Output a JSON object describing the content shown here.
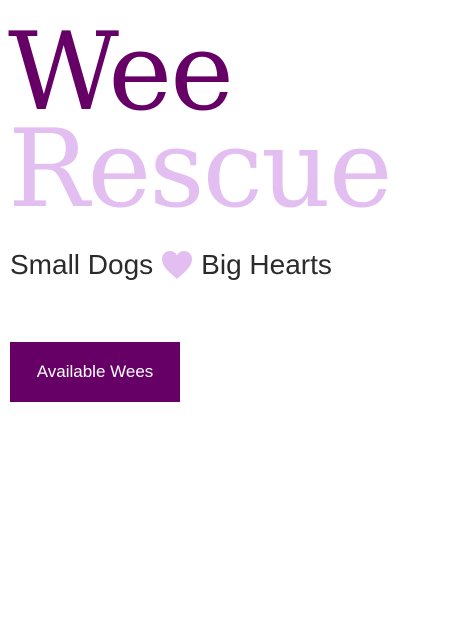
{
  "title": {
    "line1": "Wee",
    "line2": "Rescue"
  },
  "tagline": {
    "left": "Small Dogs",
    "icon": "heart-icon",
    "right": "Big Hearts"
  },
  "cta": {
    "label": "Available Wees"
  },
  "colors": {
    "primary": "#660066",
    "accent": "#e2bff0",
    "text": "#2b2b2b",
    "button_text": "#ffffff"
  }
}
